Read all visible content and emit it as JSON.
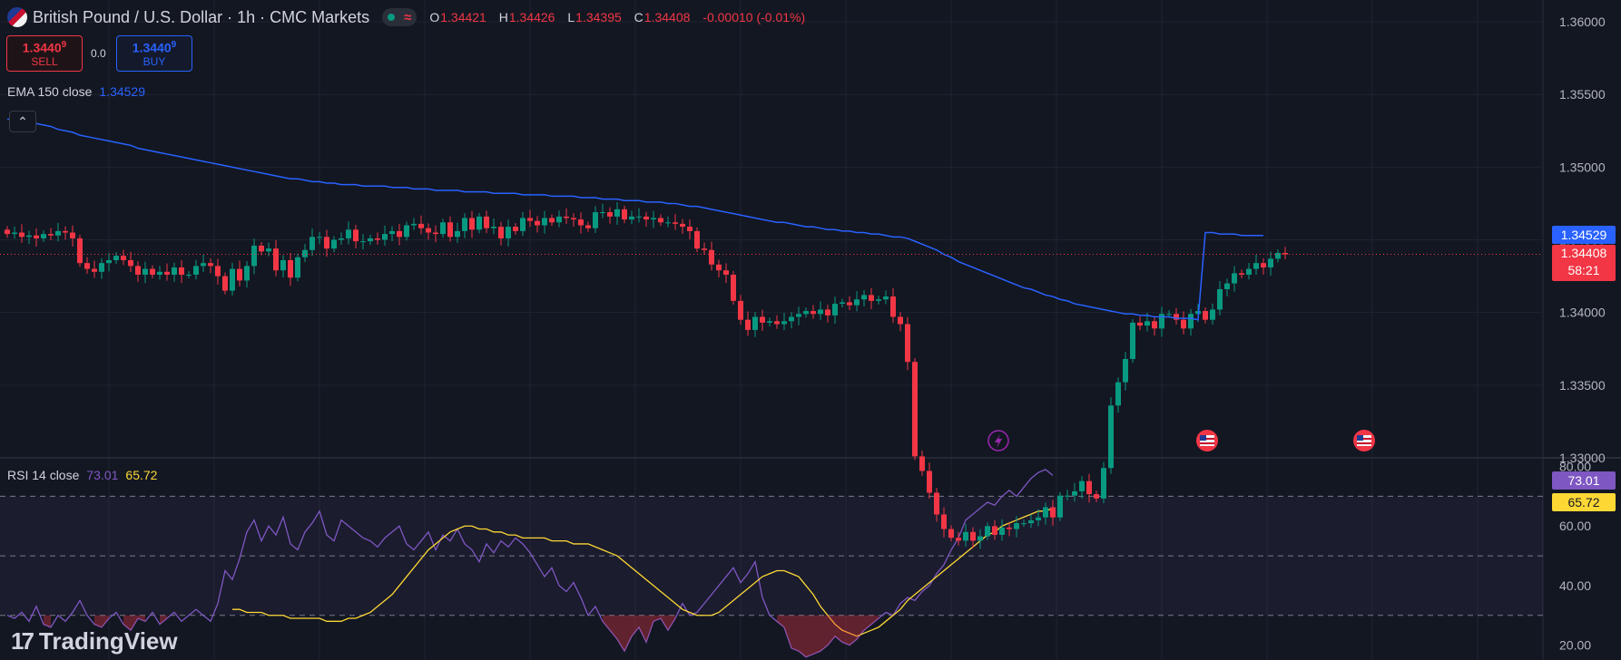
{
  "header": {
    "title": "British Pound / U.S. Dollar · 1h · CMC Markets",
    "wave_glyph": "≈",
    "ohlc": [
      {
        "key": "O",
        "value": "1.34421"
      },
      {
        "key": "H",
        "value": "1.34426"
      },
      {
        "key": "L",
        "value": "1.34395"
      },
      {
        "key": "C",
        "value": "1.34408"
      }
    ],
    "change": "-0.00010 (-0.01%)"
  },
  "trade": {
    "sell_price_main": "1.3440",
    "sell_price_sup": "9",
    "sell_label": "SELL",
    "spread": "0.0",
    "buy_price_main": "1.3440",
    "buy_price_sup": "9",
    "buy_label": "BUY"
  },
  "ema_label": {
    "name": "EMA 150 close",
    "value": "1.34529"
  },
  "rsi_label": {
    "name": "RSI 14 close",
    "value": "73.01",
    "ma_value": "65.72"
  },
  "axis_tags": {
    "ema": "1.34529",
    "price": "1.34408",
    "countdown": "58:21",
    "rsi": "73.01",
    "rsi_ma": "65.72"
  },
  "logo": {
    "mark": "17",
    "text": "TradingView"
  },
  "colors": {
    "up": "#089981",
    "down": "#f23645",
    "ema": "#2962ff",
    "rsi": "#7e57c2",
    "rsi_ma": "#fdd835",
    "background": "#131722"
  },
  "chart_data": [
    {
      "type": "candlestick",
      "name": "GBPUSD 1h",
      "ylim": [
        1.33,
        1.3615
      ],
      "yticks": [
        "1.36000",
        "1.35500",
        "1.35000",
        "1.34500",
        "1.34000",
        "1.33500",
        "1.33000"
      ],
      "close": [
        1.3454,
        1.3455,
        1.3452,
        1.3453,
        1.3451,
        1.3454,
        1.3453,
        1.3456,
        1.3455,
        1.3451,
        1.3434,
        1.343,
        1.3428,
        1.3434,
        1.3436,
        1.3439,
        1.3436,
        1.3432,
        1.3426,
        1.343,
        1.3426,
        1.3428,
        1.3426,
        1.3431,
        1.3426,
        1.3426,
        1.3432,
        1.3434,
        1.3432,
        1.3425,
        1.3415,
        1.343,
        1.3422,
        1.3432,
        1.3446,
        1.3442,
        1.3444,
        1.3429,
        1.3436,
        1.3424,
        1.3438,
        1.3443,
        1.3452,
        1.3452,
        1.3444,
        1.345,
        1.3451,
        1.3457,
        1.3449,
        1.3449,
        1.3451,
        1.345,
        1.3454,
        1.3456,
        1.3452,
        1.346,
        1.3461,
        1.3458,
        1.3455,
        1.3454,
        1.3462,
        1.3452,
        1.3456,
        1.3465,
        1.3457,
        1.3466,
        1.3458,
        1.3459,
        1.3451,
        1.3459,
        1.3456,
        1.3465,
        1.3463,
        1.346,
        1.3465,
        1.3462,
        1.3466,
        1.3465,
        1.3464,
        1.346,
        1.3458,
        1.3469,
        1.3469,
        1.3466,
        1.3471,
        1.3464,
        1.3466,
        1.3466,
        1.3464,
        1.3465,
        1.3462,
        1.3462,
        1.3461,
        1.3459,
        1.3456,
        1.3444,
        1.3443,
        1.3433,
        1.3429,
        1.3426,
        1.3408,
        1.3395,
        1.3388,
        1.3397,
        1.3393,
        1.3394,
        1.3392,
        1.3394,
        1.3397,
        1.3399,
        1.3401,
        1.3399,
        1.3402,
        1.3398,
        1.3406,
        1.3407,
        1.3405,
        1.3409,
        1.3412,
        1.3408,
        1.3409,
        1.3411,
        1.3397,
        1.3392,
        1.3366,
        1.3301,
        1.3291,
        1.3276,
        1.3261,
        1.3251,
        1.3245,
        1.3243,
        1.3249,
        1.3243,
        1.3246,
        1.3253,
        1.3247,
        1.3252,
        1.3251,
        1.3255,
        1.3255,
        1.3257,
        1.3259,
        1.3266,
        1.3259,
        1.3274,
        1.3274,
        1.3277,
        1.3284,
        1.3275,
        1.3272,
        1.3293,
        1.3336,
        1.3352,
        1.3368,
        1.3393,
        1.3391,
        1.3394,
        1.3389,
        1.3399,
        1.3399,
        1.3395,
        1.3389,
        1.3399,
        1.3401,
        1.3395,
        1.3402,
        1.3416,
        1.342,
        1.3427,
        1.3426,
        1.343,
        1.3434,
        1.3431,
        1.3437,
        1.3441,
        1.344
      ],
      "ema_150": [
        1.3533,
        1.3533,
        1.3532,
        1.3531,
        1.353,
        1.3529,
        1.3528,
        1.3526,
        1.3525,
        1.3524,
        1.3522,
        1.3521,
        1.352,
        1.3519,
        1.3518,
        1.3517,
        1.3516,
        1.3515,
        1.3513,
        1.3512,
        1.3511,
        1.351,
        1.3509,
        1.3508,
        1.3507,
        1.3506,
        1.3505,
        1.3504,
        1.3503,
        1.3502,
        1.3501,
        1.35,
        1.3499,
        1.3498,
        1.3497,
        1.3496,
        1.3495,
        1.3494,
        1.3493,
        1.3492,
        1.3492,
        1.3491,
        1.349,
        1.349,
        1.3489,
        1.3489,
        1.3488,
        1.3488,
        1.3488,
        1.3487,
        1.3487,
        1.3487,
        1.3487,
        1.3486,
        1.3486,
        1.3486,
        1.3485,
        1.3485,
        1.3485,
        1.3484,
        1.3484,
        1.3484,
        1.3484,
        1.3483,
        1.3483,
        1.3483,
        1.3483,
        1.3482,
        1.3482,
        1.3482,
        1.3482,
        1.3481,
        1.3481,
        1.3481,
        1.3481,
        1.348,
        1.348,
        1.348,
        1.348,
        1.3479,
        1.3479,
        1.3479,
        1.3478,
        1.3478,
        1.3478,
        1.3477,
        1.3477,
        1.3477,
        1.3476,
        1.3476,
        1.3476,
        1.3475,
        1.3475,
        1.3474,
        1.3473,
        1.3473,
        1.3472,
        1.3471,
        1.347,
        1.3469,
        1.3468,
        1.3467,
        1.3466,
        1.3465,
        1.3464,
        1.3463,
        1.3462,
        1.3462,
        1.3461,
        1.346,
        1.3459,
        1.3459,
        1.3458,
        1.3457,
        1.3457,
        1.3456,
        1.3456,
        1.3455,
        1.3455,
        1.3454,
        1.3454,
        1.3453,
        1.3452,
        1.3452,
        1.3451,
        1.3449,
        1.3447,
        1.3445,
        1.3443,
        1.344,
        1.3438,
        1.3435,
        1.3433,
        1.3431,
        1.3429,
        1.3427,
        1.3425,
        1.3423,
        1.3421,
        1.3419,
        1.3417,
        1.3416,
        1.3414,
        1.3412,
        1.3411,
        1.3409,
        1.3408,
        1.3406,
        1.3405,
        1.3404,
        1.3403,
        1.3402,
        1.3401,
        1.34,
        1.3399,
        1.3399,
        1.3398,
        1.3398,
        1.3397,
        1.3397,
        1.3397,
        1.3396,
        1.3396,
        1.3396,
        1.3395,
        1.3455,
        1.3455,
        1.3454,
        1.3454,
        1.3454,
        1.3453,
        1.3453,
        1.3453,
        1.3453
      ]
    },
    {
      "type": "line",
      "name": "RSI 14",
      "ylim": [
        15,
        82
      ],
      "yticks": [
        "80.00",
        "60.00",
        "40.00",
        "20.00"
      ],
      "bands": [
        70,
        50,
        30
      ],
      "rsi": [
        30,
        29,
        31,
        28,
        33,
        27,
        26,
        30,
        28,
        31,
        35,
        30,
        27,
        26,
        29,
        31,
        27,
        25,
        29,
        28,
        31,
        27,
        29,
        31,
        28,
        30,
        32,
        30,
        28,
        34,
        45,
        42,
        49,
        58,
        62,
        55,
        60,
        57,
        63,
        54,
        52,
        58,
        61,
        65,
        57,
        55,
        62,
        60,
        58,
        56,
        55,
        53,
        56,
        58,
        60,
        54,
        52,
        55,
        58,
        52,
        57,
        55,
        59,
        54,
        52,
        48,
        54,
        51,
        55,
        53,
        56,
        54,
        51,
        47,
        43,
        46,
        40,
        38,
        41,
        36,
        30,
        33,
        28,
        25,
        22,
        18,
        23,
        26,
        21,
        28,
        29,
        25,
        29,
        34,
        30,
        31,
        34,
        37,
        40,
        43,
        46,
        41,
        44,
        48,
        36,
        30,
        28,
        26,
        19,
        18,
        16,
        17,
        18,
        20,
        23,
        21,
        20,
        22,
        25,
        27,
        29,
        31,
        30,
        34,
        36,
        35,
        38,
        40,
        44,
        47,
        52,
        56,
        62,
        64,
        66,
        68,
        67,
        70,
        72,
        70,
        73,
        76,
        78,
        79,
        77
      ],
      "rsi_ma": [
        32,
        32,
        31,
        31,
        31,
        30,
        30,
        30,
        29,
        29,
        29,
        29,
        29,
        28,
        28,
        28,
        29,
        29,
        30,
        31,
        33,
        35,
        37,
        40,
        43,
        46,
        49,
        52,
        54,
        56,
        58,
        59,
        60,
        60,
        59,
        59,
        58,
        58,
        57,
        57,
        56,
        56,
        56,
        56,
        55,
        55,
        55,
        54,
        54,
        54,
        53,
        52,
        51,
        50,
        48,
        46,
        44,
        42,
        40,
        38,
        36,
        34,
        32,
        31,
        30,
        30,
        30,
        31,
        33,
        35,
        37,
        39,
        41,
        43,
        44,
        45,
        45,
        44,
        43,
        40,
        37,
        33,
        30,
        27,
        25,
        24,
        23,
        24,
        25,
        26,
        28,
        30,
        32,
        35,
        37,
        39,
        41,
        43,
        45,
        47,
        49,
        51,
        53,
        55,
        57,
        58,
        60,
        61,
        62,
        63,
        64,
        65,
        65,
        66
      ]
    }
  ]
}
